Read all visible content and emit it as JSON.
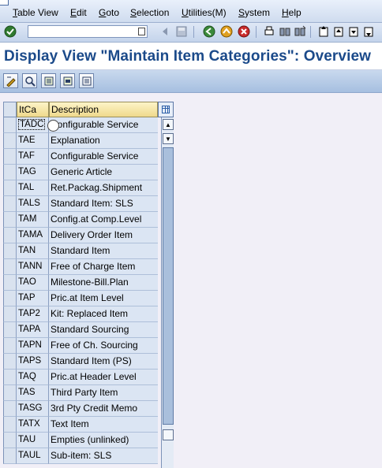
{
  "menu": [
    {
      "label": "Table View",
      "u": "T",
      "rest": "able View"
    },
    {
      "label": "Edit",
      "u": "E",
      "rest": "dit"
    },
    {
      "label": "Goto",
      "u": "G",
      "rest": "oto"
    },
    {
      "label": "Selection",
      "u": "S",
      "rest": "election"
    },
    {
      "label": "Utilities(M)",
      "u": "U",
      "rest": "tilities(M)"
    },
    {
      "label": "System",
      "u": "S",
      "rest": "ystem"
    },
    {
      "label": "Help",
      "u": "H",
      "rest": "elp"
    }
  ],
  "command_field": {
    "value": ""
  },
  "page_title": "Display View \"Maintain Item Categories\": Overview",
  "table": {
    "headers": [
      "ItCa",
      "Description"
    ],
    "rows": [
      {
        "code": "TADC",
        "desc": "Configurable Service"
      },
      {
        "code": "TAE",
        "desc": "Explanation"
      },
      {
        "code": "TAF",
        "desc": "Configurable Service"
      },
      {
        "code": "TAG",
        "desc": "Generic Article"
      },
      {
        "code": "TAL",
        "desc": "Ret.Packag.Shipment"
      },
      {
        "code": "TALS",
        "desc": "Standard Item: SLS"
      },
      {
        "code": "TAM",
        "desc": "Config.at Comp.Level"
      },
      {
        "code": "TAMA",
        "desc": "Delivery Order Item"
      },
      {
        "code": "TAN",
        "desc": "Standard Item"
      },
      {
        "code": "TANN",
        "desc": "Free of Charge Item"
      },
      {
        "code": "TAO",
        "desc": "Milestone-Bill.Plan"
      },
      {
        "code": "TAP",
        "desc": "Pric.at Item Level"
      },
      {
        "code": "TAP2",
        "desc": "Kit: Replaced Item"
      },
      {
        "code": "TAPA",
        "desc": "Standard Sourcing"
      },
      {
        "code": "TAPN",
        "desc": "Free of Ch. Sourcing"
      },
      {
        "code": "TAPS",
        "desc": "Standard Item (PS)"
      },
      {
        "code": "TAQ",
        "desc": "Pric.at Header Level"
      },
      {
        "code": "TAS",
        "desc": "Third Party Item"
      },
      {
        "code": "TASG",
        "desc": "3rd Pty Credit Memo"
      },
      {
        "code": "TATX",
        "desc": "Text Item"
      },
      {
        "code": "TAU",
        "desc": "Empties (unlinked)"
      },
      {
        "code": "TAUL",
        "desc": "Sub-item: SLS"
      }
    ]
  },
  "colors": {
    "title_blue": "#1b4a8a",
    "row_bg": "#dbe5f3",
    "header_bg": "#efd98c"
  }
}
